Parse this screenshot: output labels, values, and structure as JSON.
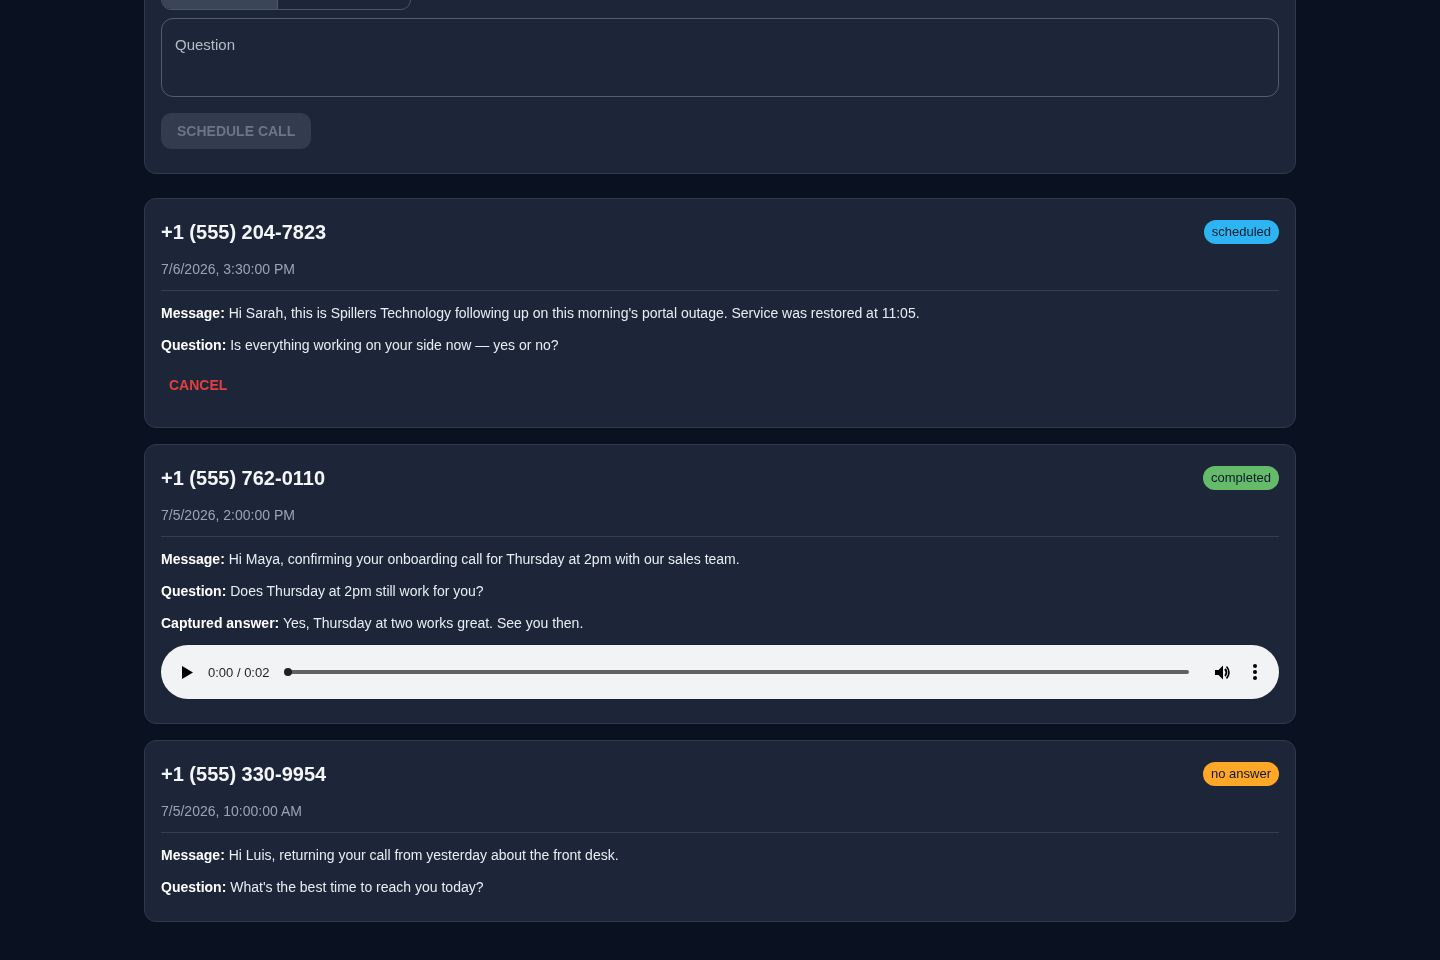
{
  "schedule_form": {
    "mode_toggle": [
      {
        "selected": true
      },
      {
        "selected": false
      }
    ],
    "question_field": {
      "placeholder": "Question"
    },
    "submit_button": {
      "label": "SCHEDULE CALL",
      "disabled": true
    }
  },
  "calls": [
    {
      "phone": "+1 (555) 204-7823",
      "status": {
        "label": "scheduled",
        "color": "#2cb5f2"
      },
      "datetime": "7/6/2026, 3:30:00 PM",
      "details": [
        "**Message:** Hi Sarah, this is Spillers Technology following up on this morning's portal outage. Service was restored at 11:05.",
        "**Question:** Is everything working on your side now — yes or no?"
      ],
      "cancel_button": {
        "label": "CANCEL"
      }
    },
    {
      "phone": "+1 (555) 762-0110",
      "status": {
        "label": "completed",
        "color": "#66bb6a"
      },
      "datetime": "7/5/2026, 2:00:00 PM",
      "details": [
        "**Message:** Hi Maya, confirming your onboarding call for Thursday at 2pm with our sales team.",
        "**Question:** Does Thursday at 2pm still work for you?",
        "**Captured answer:** Yes, Thursday at two works great. See you then."
      ],
      "recording": {
        "time": "0:00 / 0:02",
        "level": 0
      }
    },
    {
      "phone": "+1 (555) 330-9954",
      "status": {
        "label": "no answer",
        "color": "#ffa726"
      },
      "datetime": "7/5/2026, 10:00:00 AM",
      "details": [
        "**Message:** Hi Luis, returning your call from yesterday about the front desk.",
        "**Question:** What's the best time to reach you today?"
      ]
    }
  ]
}
